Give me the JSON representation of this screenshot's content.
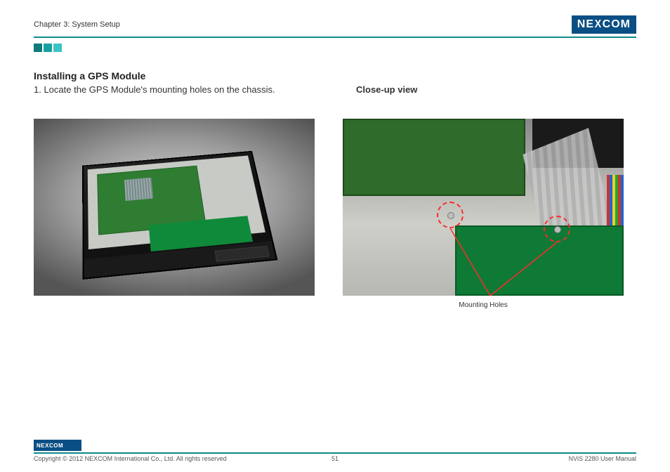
{
  "header": {
    "chapter": "Chapter 3: System Setup",
    "brand": "NEXCOM"
  },
  "content": {
    "section_title": "Installing a GPS Module",
    "step_text": "1. Locate the GPS Module's mounting holes on the chassis.",
    "closeup_label": "Close-up view",
    "callout_label": "Mounting Holes"
  },
  "footer": {
    "brand": "NEXCOM",
    "copyright": "Copyright © 2012 NEXCOM International Co., Ltd. All rights reserved",
    "page_number": "51",
    "doc_title": "NViS 2280 User Manual"
  }
}
